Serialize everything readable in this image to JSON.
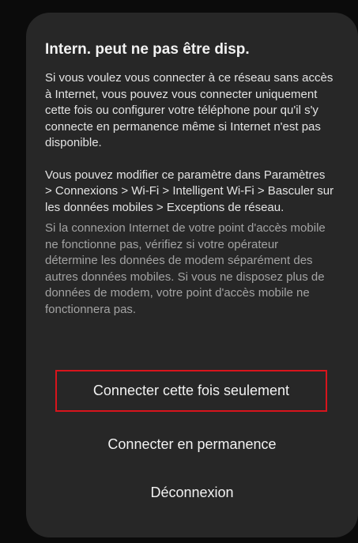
{
  "dialog": {
    "title": "Intern. peut ne pas être disp.",
    "paragraph_1": "Si vous voulez vous connecter à ce réseau sans accès à Internet, vous pouvez vous connecter uniquement cette fois ou configurer votre téléphone pour qu'il s'y connecte en permanence même si Internet n'est pas disponible.",
    "paragraph_2": "Vous pouvez modifier ce paramètre dans Paramètres > Connexions > Wi-Fi > Intelligent Wi-Fi > Basculer sur les données mobiles > Exceptions de réseau.",
    "paragraph_3": "Si la connexion Internet de votre point d'accès mobile ne fonctionne pas, vérifiez si votre opérateur détermine les données de modem séparément des autres données mobiles. Si vous ne disposez plus de données de modem, votre point d'accès mobile ne fonctionnera pas.",
    "actions": {
      "connect_once": "Connecter cette fois seulement",
      "connect_always": "Connecter en permanence",
      "disconnect": "Déconnexion"
    }
  },
  "colors": {
    "background": "#0b0b0b",
    "dialog": "#272727",
    "highlight_border": "#d8141c",
    "muted_text": "#a3a3a3"
  }
}
